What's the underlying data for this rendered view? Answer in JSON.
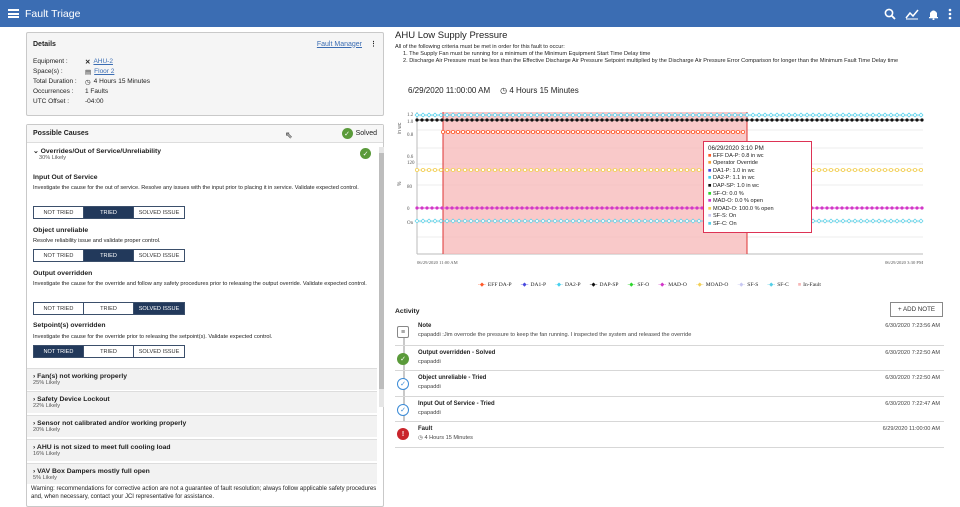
{
  "app": {
    "title": "Fault Triage"
  },
  "details": {
    "heading": "Details",
    "manager_link": "Fault Manager",
    "more": "⋮",
    "rows": [
      {
        "k": "Equipment :",
        "v": "AHU-2",
        "icon": "x-icon"
      },
      {
        "k": "Space(s) :",
        "v": "Floor 2",
        "icon": "floor-icon"
      },
      {
        "k": "Total Duration :",
        "v": "4 Hours 15 Minutes",
        "icon": "clock-icon"
      },
      {
        "k": "Occurrences :",
        "v": "1 Faults"
      },
      {
        "k": "UTC Offset :",
        "v": "-04:00"
      }
    ]
  },
  "causes": {
    "heading": "Possible Causes",
    "solved": "Solved",
    "group1": {
      "title": "Overrides/Out of Service/Unreliability",
      "likely": "30% Likely"
    },
    "items": [
      {
        "title": "Input Out of Service",
        "desc": "Investigate the cause for the out of service. Resolve any issues with the input prior to placing it in service. Validate expected control.",
        "state": "TRIED"
      },
      {
        "title": "Object unreliable",
        "desc": "Resolve reliability issue and validate proper control.",
        "state": "TRIED"
      },
      {
        "title": "Output overridden",
        "desc": "Investigate the cause for the override and follow any safety procedures prior to releasing the output override. Validate expected control.",
        "state": "SOLVED ISSUE"
      },
      {
        "title": "Setpoint(s) overridden",
        "desc": "Investigate the cause for the override prior to releasing the setpoint(s). Validate expected control.",
        "state": "NOT TRIED"
      }
    ],
    "buttons": [
      "NOT TRIED",
      "TRIED",
      "SOLVED ISSUE"
    ],
    "groups": [
      {
        "title": "Fan(s) not working properly",
        "likely": "25% Likely"
      },
      {
        "title": "Safety Device Lockout",
        "likely": "22% Likely"
      },
      {
        "title": "Sensor not calibrated and/or working properly",
        "likely": "20% Likely"
      },
      {
        "title": "AHU is not sized to meet full cooling load",
        "likely": "16% Likely"
      },
      {
        "title": "VAV Box Dampers mostly full open",
        "likely": "5% Likely"
      }
    ],
    "warning": "Warning: recommendations for corrective action are not a guarantee of fault resolution; always follow applicable safety procedures and, when necessary, contact your JCI representative for assistance."
  },
  "fault": {
    "title": "AHU Low Supply Pressure",
    "criteria_intro": "All of the following criteria must be met in order for this fault to occur:",
    "criteria": [
      "1. The Supply Fan must be running for a minimum of the Minimum Equipment Start Time Delay time",
      "2. Discharge Air Pressure must be less than the Effective Discharge Air Pressure Setpoint multiplied by the Discharge Air Pressure Error Comparison for longer than the Minimum Fault Time Delay time"
    ],
    "start": "6/29/2020 11:00:00 AM",
    "duration": "4 Hours 15 Minutes"
  },
  "chart_data": {
    "type": "line",
    "x_start": "06/29/2020 11:00 AM",
    "x_end": "06/29/2020 3:30 PM",
    "tooltip": [
      "06/29/2020 3:10 PM",
      "EFF DA-P: 0.8 in wc",
      "Operator Override",
      "DA1-P: 1.0 in wc",
      "DA2-P: 1.1 in wc",
      "DAP-SP: 1.0 in wc",
      "SF-O: 0.0 %",
      "MAD-O: 0.0 % open",
      "MOAD-O: 100.0 % open",
      "SF-S: On",
      "SF-C: On"
    ],
    "y_labels": [
      "1.2",
      "1.0",
      "0.8",
      "0.6",
      "120",
      "80",
      "0",
      "On"
    ],
    "y_units": [
      "in wc",
      "%"
    ],
    "series": [
      {
        "name": "EFF DA-P",
        "color": "#ff5a2a"
      },
      {
        "name": "DA1-P",
        "color": "#4a4adf"
      },
      {
        "name": "DA2-P",
        "color": "#45d0ee"
      },
      {
        "name": "DAP-SP",
        "color": "#111111"
      },
      {
        "name": "SF-O",
        "color": "#2fd62f"
      },
      {
        "name": "MAD-O",
        "color": "#d236c8"
      },
      {
        "name": "MOAD-O",
        "color": "#f2cf55"
      },
      {
        "name": "SF-S",
        "color": "#c8c8f2"
      },
      {
        "name": "SF-C",
        "color": "#54cfe7"
      },
      {
        "name": "In-Fault",
        "color": "#f7b7b7"
      }
    ]
  },
  "activity": {
    "heading": "Activity",
    "add_note": "+ ADD NOTE",
    "entries": [
      {
        "title": "Note",
        "body": "cpapaddi :Jim overrode the pressure to keep the fan running.  I inspected the system and released the override",
        "date": "6/30/2020 7:23:56 AM"
      },
      {
        "title": "Output overridden - Solved",
        "body": "cpapaddi",
        "date": "6/30/2020 7:22:50 AM"
      },
      {
        "title": "Object unreliable - Tried",
        "body": "cpapaddi",
        "date": "6/30/2020 7:22:50 AM"
      },
      {
        "title": "Input Out of Service - Tried",
        "body": "cpapaddi",
        "date": "6/30/2020 7:22:47 AM"
      },
      {
        "title": "Fault",
        "body": "4 Hours 15 Minutes",
        "date": "6/29/2020 11:00:00 AM"
      }
    ]
  }
}
